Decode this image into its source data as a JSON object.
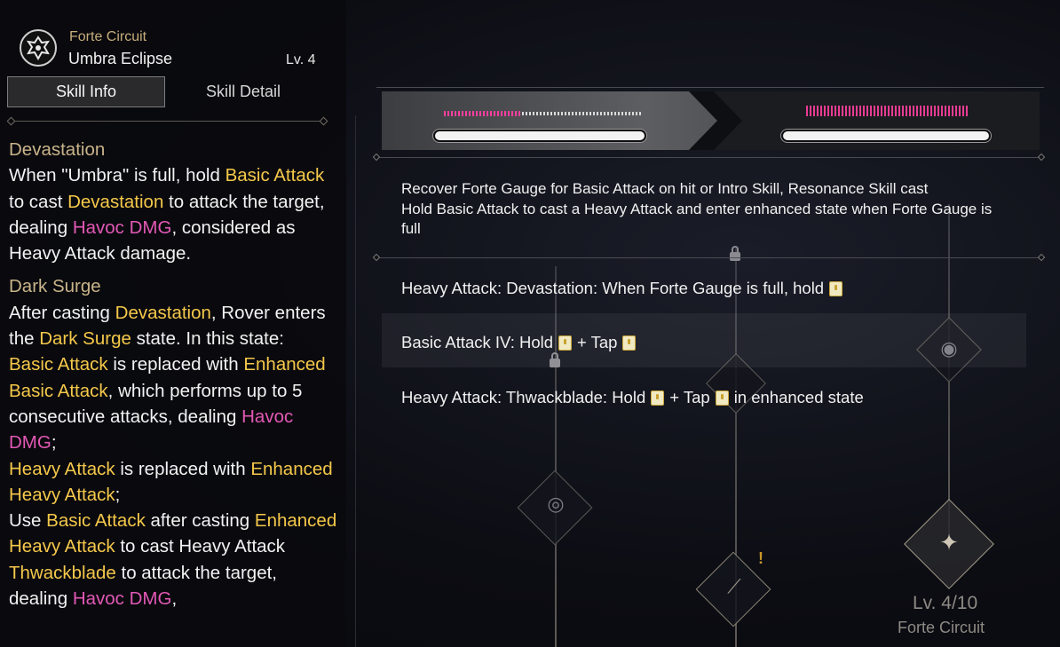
{
  "skill": {
    "category": "Forte Circuit",
    "name": "Umbra Eclipse",
    "level": "Lv. 4"
  },
  "tabs": {
    "info": "Skill Info",
    "detail": "Skill Detail"
  },
  "description": {
    "sec1_title": "Devastation",
    "sec1": [
      "When \"Umbra\" is full, hold ",
      "Basic Attack",
      " to cast ",
      "Devastation",
      " to attack the target, dealing ",
      "Havoc DMG",
      ", considered as Heavy Attack damage."
    ],
    "sec2_title": "Dark Surge",
    "sec2": [
      "After casting ",
      "Devastation",
      ", Rover enters the ",
      "Dark Surge",
      " state. In this state:"
    ],
    "l1": [
      "Basic Attack",
      " is replaced with ",
      "Enhanced Basic Attack",
      ", which performs up to 5 consecutive attacks, dealing ",
      "Havoc DMG",
      ";"
    ],
    "l2": [
      "Heavy Attack",
      " is replaced with ",
      "Enhanced Heavy Attack",
      ";"
    ],
    "l3": [
      "Use ",
      "Basic Attack",
      " after casting ",
      "Enhanced Heavy Attack",
      " to cast Heavy Attack ",
      "Thwackblade",
      " to attack the target, dealing ",
      "Havoc DMG",
      ","
    ]
  },
  "detail": {
    "summary_line1": "Recover Forte Gauge for Basic Attack on hit or Intro Skill, Resonance Skill cast",
    "summary_line2": "Hold Basic Attack to cast a Heavy Attack and enter enhanced state when Forte Gauge is full",
    "row1": "Heavy Attack: Devastation: When Forte Gauge is full, hold",
    "row2_a": "Basic Attack IV: Hold",
    "row2_b": "+ Tap",
    "row3_a": "Heavy Attack: Thwackblade: Hold",
    "row3_b": "+ Tap",
    "row3_c": "in enhanced state"
  },
  "tree": {
    "level": "Lv. 4/10",
    "label": "Forte Circuit"
  },
  "colors": {
    "highlight_yellow": "#f5c84a",
    "havoc_pink": "#e258b4",
    "heading_gold": "#c9b48a"
  }
}
